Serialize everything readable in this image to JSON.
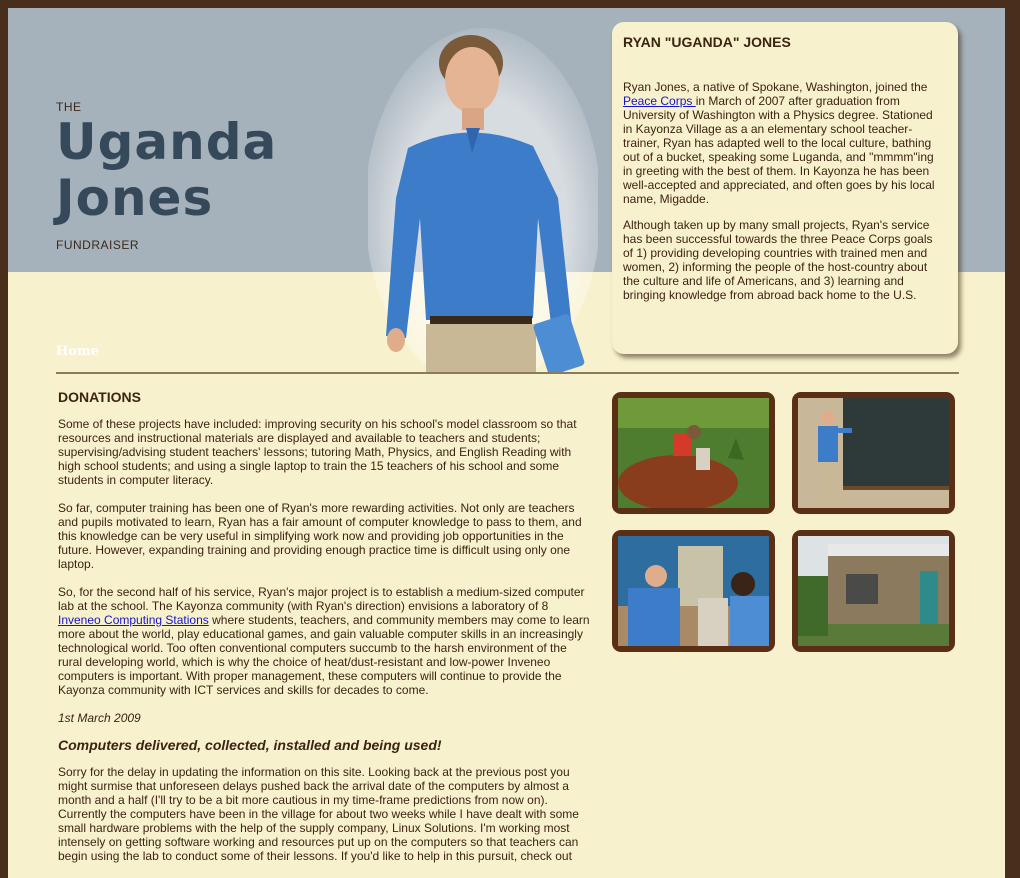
{
  "header": {
    "the": "THE",
    "title_line1": "Uganda",
    "title_line2": "Jones",
    "subtitle": "FUNDRAISER"
  },
  "nav": {
    "home": "Home"
  },
  "bio": {
    "title": "RYAN \"UGANDA\" JONES",
    "p1_before": "Ryan Jones, a native of Spokane, Washington, joined the ",
    "p1_link": "Peace Corps ",
    "p1_after": "in March of 2007 after graduation from University of Washington with a Physics degree. Stationed in Kayonza Village as a an elementary school teacher-trainer, Ryan has adapted well to the local culture, bathing out of a bucket, speaking some Luganda, and \"mmmm\"ing in greeting with the best of them.  In Kayonza he has been well-accepted and appreciated, and often goes by his local name, Migadde.",
    "p2": "Although taken up by many small projects, Ryan's service has been successful towards the three Peace Corps goals of 1) providing developing countries with trained men and women, 2) informing the people of the host-country about the culture and life of Americans, and 3) learning and bringing knowledge from abroad back home to the U.S."
  },
  "content": {
    "heading": "DONATIONS",
    "p1": "Some of these projects have included:  improving security on his school's model classroom so that resources and instructional materials are displayed and available to teachers and students; supervising/advising student teachers' lessons; tutoring Math, Physics, and English Reading with high school students; and using a single laptop to train the 15 teachers of his school and some students in computer literacy.",
    "p2": "So far, computer training has been one of Ryan's more rewarding activities.  Not only are teachers and pupils motivated to learn, Ryan has a fair amount of computer knowledge to pass to them, and this knowledge can be very useful in simplifying work now and providing job opportunities in the future.  However, expanding training and providing enough practice time is difficult using only one laptop.",
    "p3_before": "So, for the second half of his service, Ryan's major project is to establish a medium-sized computer lab at the school. The Kayonza community (with Ryan's direction) envisions a laboratory of 8 ",
    "p3_link": "Inveneo Computing Stations",
    "p3_after": " where students, teachers, and community members may come to learn more about the world, play educational games, and gain valuable computer skills in an increasingly technological world.  Too often conventional computers succumb to the harsh environment of the rural developing world, which is why the choice of heat/dust-resistant and low-power Inveneo computers is important.  With proper management, these computers will continue to provide the Kayonza community with ICT services and skills for decades to come.",
    "date": "1st March 2009",
    "post_title": "Computers delivered, collected, installed and being used!",
    "post_p1": "Sorry for the delay in updating the information on this site.  Looking back at the previous post you might surmise that unforeseen delays pushed back the arrival date of the computers by almost a month and a half (I'll try to be a bit more cautious in my time-frame predictions from now on). Currently the computers have been in the village for about two weeks while I have dealt with some small hardware problems with the help of the supply company, Linux Solutions.  I'm working most intensely on getting software working and resources put up on the computers so that teachers can begin using the lab to conduct some of their lessons.  If you'd like to help in this pursuit, check out"
  },
  "colors": {
    "header_band": "#a5b1bb",
    "page_bg": "#f8f1cd",
    "frame": "#4a2e1c",
    "title": "#36495a",
    "link": "#1515c8"
  }
}
